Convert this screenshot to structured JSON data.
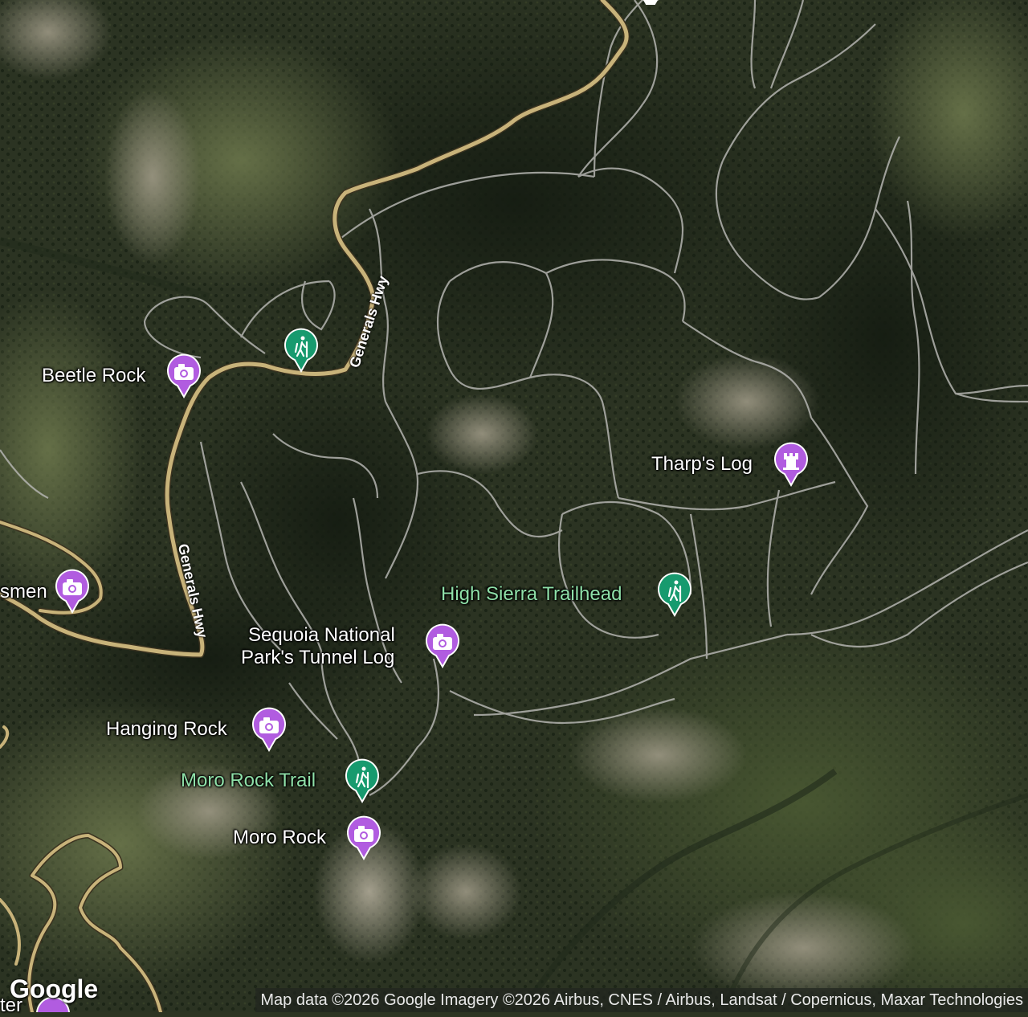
{
  "map": {
    "colors": {
      "road": "#c8b37a",
      "trail": "#b8b8b8",
      "forest_dark": "#1f2818",
      "forest_mid": "#34402a",
      "rock": "#8c8a78",
      "pin_purple": "#b15ce0",
      "pin_green": "#179a6e",
      "trail_label": "#8fe0a8"
    },
    "roads": [
      {
        "label": "Generals Hwy"
      },
      {
        "label": "Generals Hwy"
      }
    ],
    "places": [
      {
        "label": "Beetle Rock",
        "icon": "camera-icon",
        "kind": "viewpoint"
      },
      {
        "label": "Tharp's Log",
        "icon": "castle-icon",
        "kind": "historic"
      },
      {
        "label": "High Sierra Trailhead",
        "icon": "hiker-icon",
        "kind": "trail"
      },
      {
        "label": "Sequoia National",
        "label2": "Park's Tunnel Log",
        "icon": "camera-icon",
        "kind": "viewpoint"
      },
      {
        "label": "Hanging Rock",
        "icon": "camera-icon",
        "kind": "viewpoint"
      },
      {
        "label": "Moro Rock Trail",
        "icon": "hiker-icon",
        "kind": "trail"
      },
      {
        "label": "Moro Rock",
        "icon": "camera-icon",
        "kind": "viewpoint"
      },
      {
        "label": "smen",
        "icon": "camera-icon",
        "kind": "viewpoint"
      },
      {
        "label": "",
        "icon": "hiker-icon",
        "kind": "trail"
      },
      {
        "label": "ter",
        "icon": "camera-icon",
        "kind": "viewpoint"
      }
    ],
    "logo": "Google",
    "attribution": "Map data ©2026 Google Imagery ©2026 Airbus, CNES / Airbus, Landsat / Copernicus, Maxar Technologies"
  }
}
